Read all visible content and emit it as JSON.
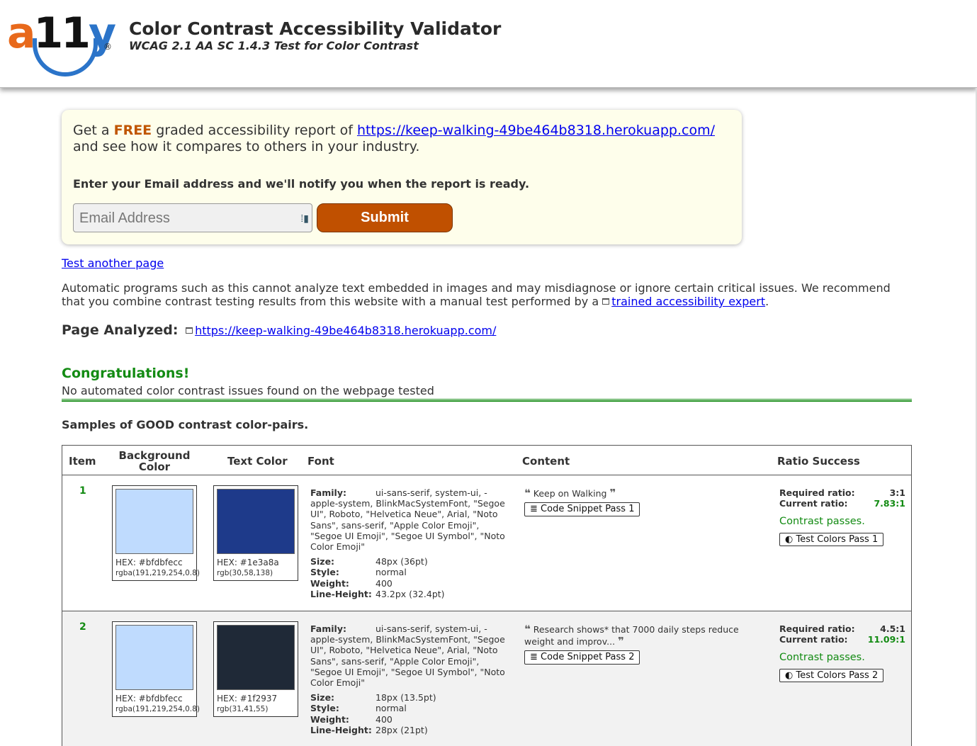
{
  "header": {
    "logo": {
      "a": "a",
      "num": "11",
      "y": "y",
      "reg": "®"
    },
    "title": "Color Contrast Accessibility Validator",
    "subtitle": "WCAG 2.1 AA SC 1.4.3 Test for Color Contrast"
  },
  "promo": {
    "get_a": "Get a ",
    "free": "FREE",
    "graded": " graded accessibility report of ",
    "url": "https://keep-walking-49be464b8318.herokuapp.com/",
    "line2": "and see how it compares to others in your industry.",
    "notify": "Enter your Email address and we'll notify you when the report is ready.",
    "email_placeholder": "Email Address",
    "submit_label": "Submit"
  },
  "test_another": "Test another page",
  "disclaimer": {
    "text": "Automatic programs such as this cannot analyze text embedded in images and may misdiagnose or ignore certain critical issues. We recommend that you combine contrast testing results from this website with a manual test performed by a ",
    "link": "trained accessibility expert",
    "end": "."
  },
  "page_analyzed": {
    "label": "Page Analyzed:",
    "url": "https://keep-walking-49be464b8318.herokuapp.com/"
  },
  "result": {
    "congrats": "Congratulations!",
    "message": "No automated color contrast issues found on the webpage tested"
  },
  "samples_heading": "Samples of GOOD contrast color-pairs.",
  "table": {
    "headers": {
      "item": "Item",
      "background": "Background Color",
      "text_color": "Text Color",
      "font": "Font",
      "content": "Content",
      "ratio": "Ratio Success"
    },
    "labels": {
      "family": "Family:",
      "size": "Size:",
      "style": "Style:",
      "weight": "Weight:",
      "line_height": "Line-Height:",
      "required": "Required ratio:",
      "current": "Current ratio:"
    },
    "rows": [
      {
        "item": "1",
        "bg_hex_label": "HEX: #bfdbfecc",
        "bg_rgba": "rgba(191,219,254,0.8)",
        "bg_color": "#bfdbfe",
        "fg_hex_label": "HEX: #1e3a8a",
        "fg_rgb": "rgb(30,58,138)",
        "fg_color": "#1e3a8a",
        "family_first": "ui-sans-serif, system-ui, -",
        "family_rest": "apple-system, BlinkMacSystemFont, \"Segoe UI\", Roboto, \"Helvetica Neue\", Arial, \"Noto Sans\", sans-serif, \"Apple Color Emoji\", \"Segoe UI Emoji\", \"Segoe UI Symbol\", \"Noto Color Emoji\"",
        "size": "48px (36pt)",
        "style": "normal",
        "weight": "400",
        "line_height": "43.2px (32.4pt)",
        "content": "Keep on Walking",
        "snippet_btn": "Code Snippet Pass 1",
        "required": "3:1",
        "current": "7.83:1",
        "passes": "Contrast passes.",
        "colors_btn": "Test Colors Pass 1"
      },
      {
        "item": "2",
        "bg_hex_label": "HEX: #bfdbfecc",
        "bg_rgba": "rgba(191,219,254,0.8)",
        "bg_color": "#bfdbfe",
        "fg_hex_label": "HEX: #1f2937",
        "fg_rgb": "rgb(31,41,55)",
        "fg_color": "#1f2937",
        "family_first": "ui-sans-serif, system-ui, -",
        "family_rest": "apple-system, BlinkMacSystemFont, \"Segoe UI\", Roboto, \"Helvetica Neue\", Arial, \"Noto Sans\", sans-serif, \"Apple Color Emoji\", \"Segoe UI Emoji\", \"Segoe UI Symbol\", \"Noto Color Emoji\"",
        "size": "18px (13.5pt)",
        "style": "normal",
        "weight": "400",
        "line_height": "28px (21pt)",
        "content": "Research shows* that 7000 daily steps reduce weight and improv...",
        "snippet_btn": "Code Snippet Pass 2",
        "required": "4.5:1",
        "current": "11.09:1",
        "passes": "Contrast passes.",
        "colors_btn": "Test Colors Pass 2"
      }
    ]
  }
}
